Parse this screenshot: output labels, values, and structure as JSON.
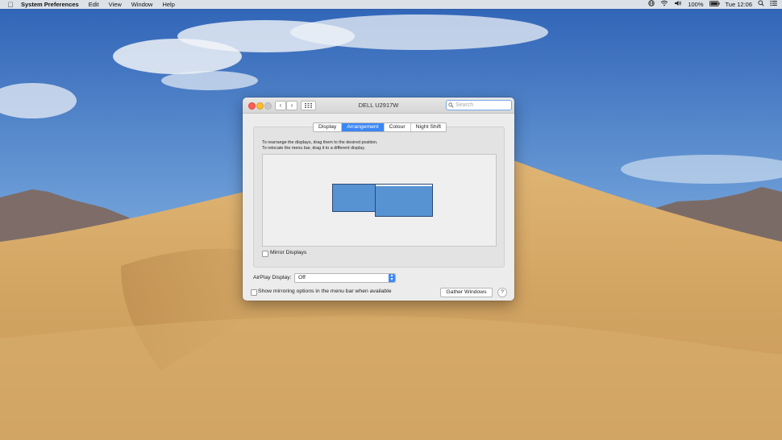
{
  "menubar": {
    "app_name": "System Preferences",
    "menus": [
      "Edit",
      "View",
      "Window",
      "Help"
    ],
    "battery_percent": "100%",
    "clock": "Tue 12:06",
    "status_icons": [
      "globe-icon",
      "wifi-icon",
      "volume-icon",
      "battery-icon",
      "spotlight-icon",
      "notification-center-icon"
    ]
  },
  "window": {
    "title": "DELL U2917W",
    "search_placeholder": "Search",
    "tabs": [
      "Display",
      "Arrangement",
      "Colour",
      "Night Shift"
    ],
    "active_tab": "Arrangement",
    "instructions_line1": "To rearrange the displays, drag them to the desired position.",
    "instructions_line2": "To relocate the menu bar, drag it to a different display.",
    "mirror_label": "Mirror Displays",
    "mirror_checked": false,
    "airplay_label": "AirPlay Display:",
    "airplay_value": "Off",
    "show_mirroring_label": "Show mirroring options in the menu bar when available",
    "show_mirroring_checked": false,
    "gather_label": "Gather Windows",
    "help_label": "?"
  },
  "colors": {
    "accent": "#3b87f4",
    "display_fill": "#5792d3"
  }
}
